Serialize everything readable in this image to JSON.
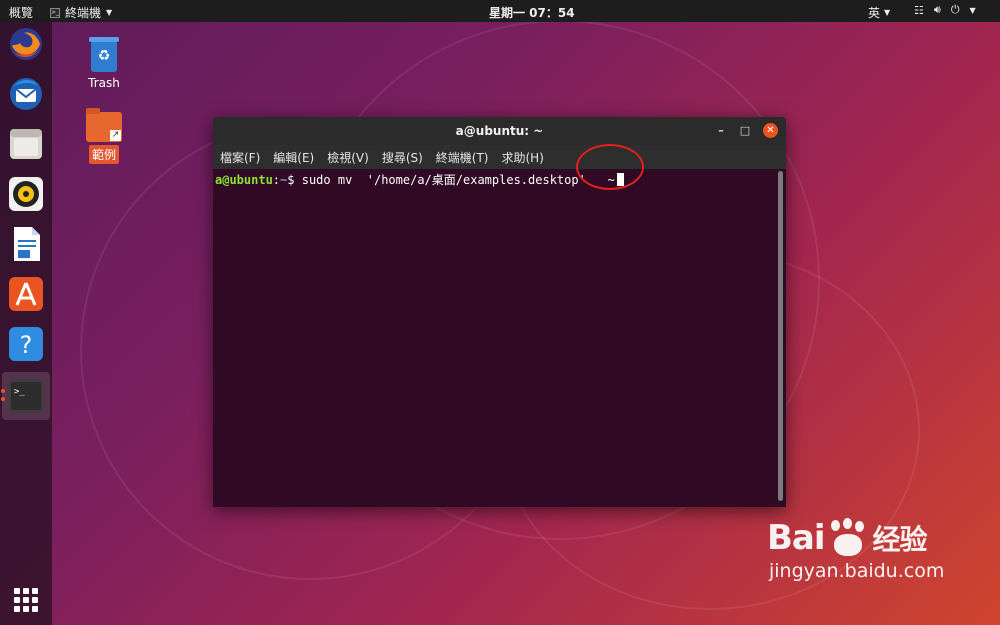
{
  "topbar": {
    "activities": "概覽",
    "app_name": "終端機",
    "clock": "星期一 07：54",
    "input_method": "英"
  },
  "dock": {
    "items": [
      "firefox-icon",
      "thunderbird-icon",
      "files-icon",
      "rhythmbox-icon",
      "libreoffice-writer-icon",
      "ubuntu-software-icon",
      "help-icon",
      "terminal-icon"
    ],
    "show_apps": "grid-icon"
  },
  "desktop": {
    "icons": [
      {
        "label": "Trash"
      },
      {
        "label": "範例"
      }
    ]
  },
  "terminal": {
    "title": "a@ubuntu: ~",
    "menu": [
      "檔案(F)",
      "編輯(E)",
      "檢視(V)",
      "搜尋(S)",
      "終端機(T)",
      "求助(H)"
    ],
    "prompt_user": "a@ubuntu",
    "prompt_sep": ":",
    "prompt_path": "~",
    "prompt_symbol": "$",
    "command": " sudo mv  '/home/a/桌面/examples.desktop'   ~"
  },
  "watermark": {
    "brand": "Bai",
    "brand_suffix": "经验",
    "url": "jingyan.baidu.com"
  },
  "colors": {
    "accent": "#e95420",
    "terminal_bg": "#300a24",
    "prompt_user": "#8ae234",
    "prompt_path": "#729fcf",
    "annotation": "#e0211c"
  }
}
